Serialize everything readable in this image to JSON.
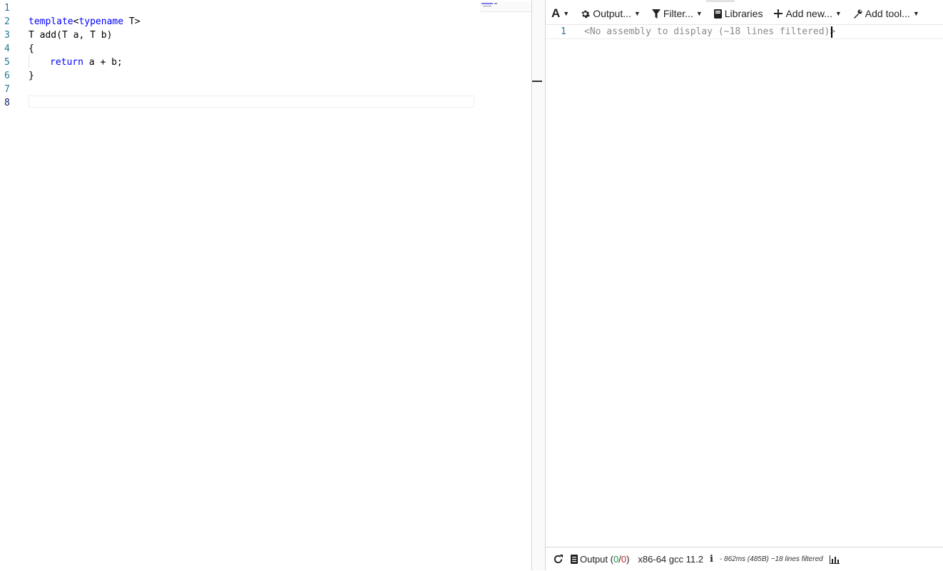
{
  "editor": {
    "line_numbers": [
      "1",
      "2",
      "3",
      "4",
      "5",
      "6",
      "7",
      "8"
    ],
    "lines": {
      "l2_kw1": "template",
      "l2_lt": "<",
      "l2_kw2": "typename",
      "l2_rest": " T>",
      "l3": "T add(T a, T b)",
      "l4": "{",
      "l5_kw": "return",
      "l5_rest": " a + b;",
      "l6": "}"
    }
  },
  "toolbar": {
    "font_label": "A",
    "output_label": "Output...",
    "filter_label": "Filter...",
    "libraries_label": "Libraries",
    "add_new_label": "Add new...",
    "add_tool_label": "Add tool..."
  },
  "assembly": {
    "line_number": "1",
    "message": "<No assembly to display (~18 lines filtered)>"
  },
  "status": {
    "output_label": "Output (",
    "ok_count": "0",
    "slash": "/",
    "err_count": "0",
    "close_paren": ")",
    "compiler": "x86-64 gcc 11.2",
    "info_icon": "i",
    "timing": "- 862ms (485B) ~18 lines filtered"
  },
  "icons": {
    "gear": "gear-icon",
    "filter": "filter-icon",
    "book": "book-icon",
    "plus": "plus-icon",
    "wrench": "wrench-icon",
    "refresh": "refresh-icon",
    "doc": "document-icon",
    "chart": "bar-chart-icon"
  },
  "colors": {
    "keyword": "#0000ff",
    "line_number": "#237893",
    "ok": "#1e8e3e",
    "error": "#c62828"
  }
}
